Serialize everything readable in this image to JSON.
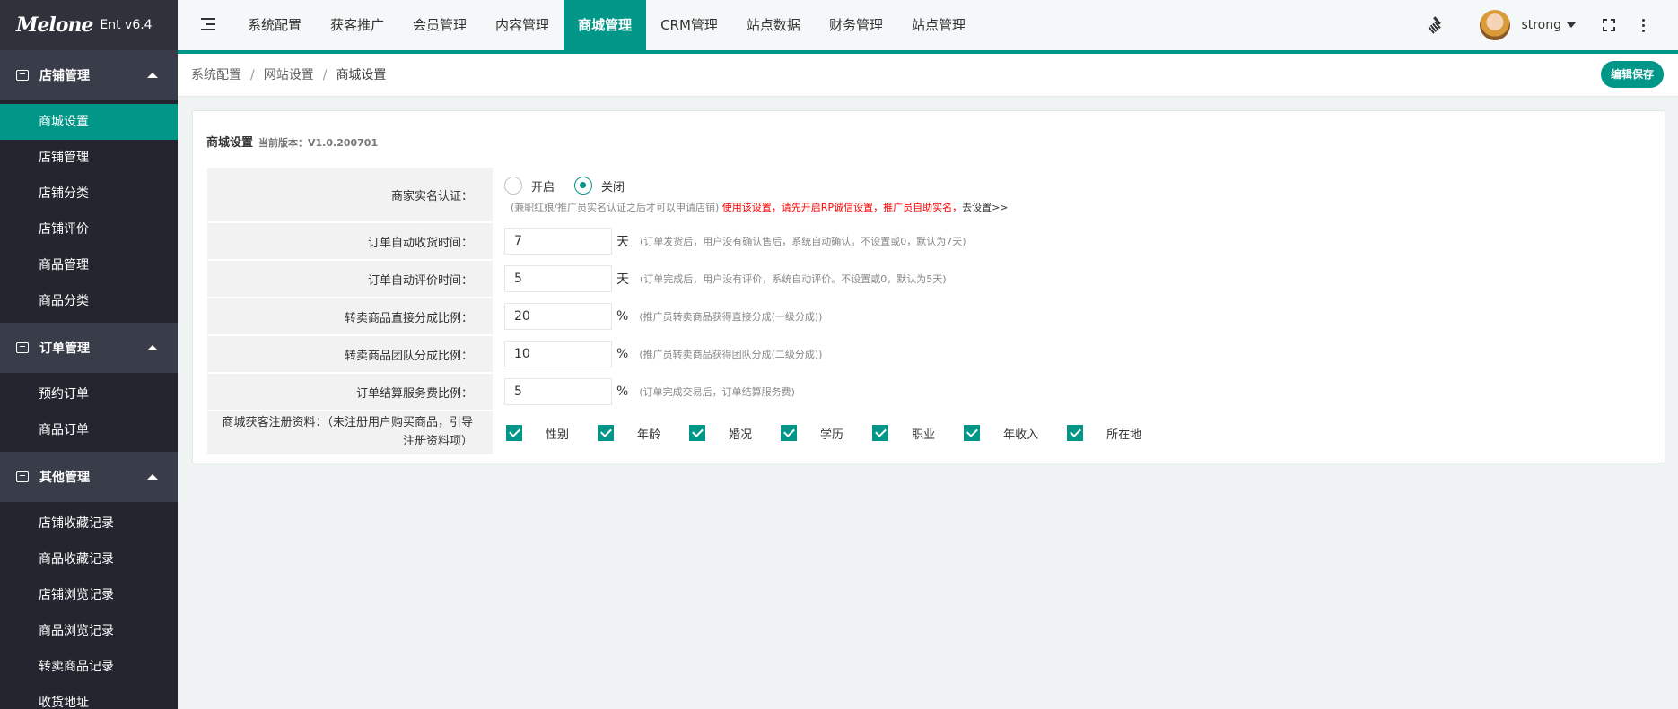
{
  "app": {
    "logo_text": "Melone",
    "version": "Ent v6.4"
  },
  "sidebar": {
    "groups": [
      {
        "title": "店铺管理",
        "items": [
          "商城设置",
          "店铺管理",
          "店铺分类",
          "店铺评价",
          "商品管理",
          "商品分类"
        ]
      },
      {
        "title": "订单管理",
        "items": [
          "预约订单",
          "商品订单"
        ]
      },
      {
        "title": "其他管理",
        "items": [
          "店铺收藏记录",
          "商品收藏记录",
          "店铺浏览记录",
          "商品浏览记录",
          "转卖商品记录",
          "收货地址"
        ]
      }
    ],
    "active_item": "商城设置"
  },
  "topnav": {
    "items": [
      "系统配置",
      "获客推广",
      "会员管理",
      "内容管理",
      "商城管理",
      "CRM管理",
      "站点数据",
      "财务管理",
      "站点管理"
    ],
    "active": "商城管理",
    "user": "strong"
  },
  "breadcrumb": {
    "items": [
      "系统配置",
      "网站设置",
      "商城设置"
    ],
    "separator": "/"
  },
  "toolbar": {
    "save_label": "编辑保存"
  },
  "card": {
    "title": "商城设置",
    "version_label": "当前版本：V1.0.200701"
  },
  "form": {
    "realname": {
      "label": "商家实名认证：",
      "options": [
        "开启",
        "关闭"
      ],
      "selected": "关闭",
      "note_gray": "(兼职红娘/推广员实名认证之后才可以申请店铺)",
      "note_red": "使用该设置，请先开启RP诚信设置，推广员自助实名，",
      "note_link": "去设置>>"
    },
    "fields": [
      {
        "label": "订单自动收货时间：",
        "value": "7",
        "unit": "天",
        "tip": "(订单发货后，用户没有确认售后，系统自动确认。不设置或0，默认为7天)"
      },
      {
        "label": "订单自动评价时间：",
        "value": "5",
        "unit": "天",
        "tip": "(订单完成后，用户没有评价，系统自动评价。不设置或0，默认为5天)"
      },
      {
        "label": "转卖商品直接分成比例：",
        "value": "20",
        "unit": "%",
        "tip": "(推广员转卖商品获得直接分成(一级分成))"
      },
      {
        "label": "转卖商品团队分成比例：",
        "value": "10",
        "unit": "%",
        "tip": "(推广员转卖商品获得团队分成(二级分成))"
      },
      {
        "label": "订单结算服务费比例：",
        "value": "5",
        "unit": "%",
        "tip": "(订单完成交易后，订单结算服务费)"
      }
    ],
    "register": {
      "label": "商城获客注册资料：（未注册用户购买商品，引导注册资料项）",
      "options": [
        "性别",
        "年龄",
        "婚况",
        "学历",
        "职业",
        "年收入",
        "所在地"
      ]
    }
  },
  "colors": {
    "accent": "#009688",
    "sidebar_bg": "#23262e",
    "group_bg": "#393d49",
    "warn": "#ff0000"
  }
}
